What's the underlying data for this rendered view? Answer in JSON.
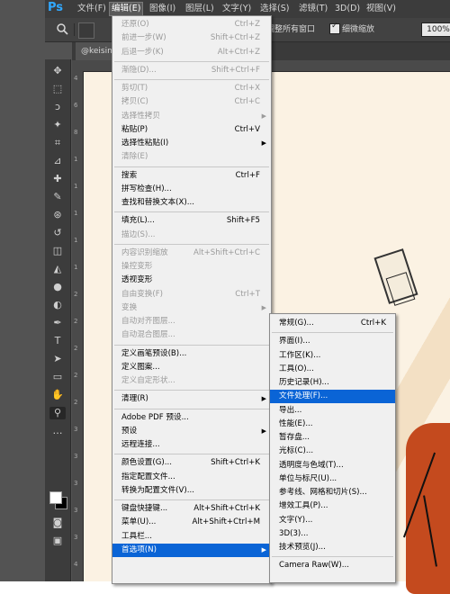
{
  "app": {
    "logo": "Ps"
  },
  "menubar": [
    "文件(F)",
    "编辑(E)",
    "图像(I)",
    "图层(L)",
    "文字(Y)",
    "选择(S)",
    "滤镜(T)",
    "3D(D)",
    "视图(V)"
  ],
  "options": {
    "check1_label": "调整所有窗口",
    "check2_label": "细微缩放",
    "zoom": "100%"
  },
  "tab": {
    "label": "@keisin"
  },
  "ruler": [
    "4",
    "6",
    "8",
    "1",
    "1",
    "1",
    "1",
    "1",
    "2",
    "2",
    "2",
    "2",
    "2",
    "3",
    "3",
    "3",
    "3",
    "3",
    "4"
  ],
  "edit_menu": [
    {
      "label": "还原(O)",
      "shortcut": "Ctrl+Z",
      "disabled": true
    },
    {
      "label": "前进一步(W)",
      "shortcut": "Shift+Ctrl+Z",
      "disabled": true
    },
    {
      "label": "后退一步(K)",
      "shortcut": "Alt+Ctrl+Z",
      "disabled": true
    },
    {
      "sep": true
    },
    {
      "label": "渐隐(D)...",
      "shortcut": "Shift+Ctrl+F",
      "disabled": true
    },
    {
      "sep": true
    },
    {
      "label": "剪切(T)",
      "shortcut": "Ctrl+X",
      "disabled": true
    },
    {
      "label": "拷贝(C)",
      "shortcut": "Ctrl+C",
      "disabled": true
    },
    {
      "label": "选择性拷贝",
      "shortcut": "",
      "disabled": true,
      "submenu": true
    },
    {
      "label": "粘贴(P)",
      "shortcut": "Ctrl+V",
      "disabled": false
    },
    {
      "label": "选择性粘贴(I)",
      "shortcut": "",
      "disabled": false,
      "submenu": true
    },
    {
      "label": "清除(E)",
      "shortcut": "",
      "disabled": true
    },
    {
      "sep": true
    },
    {
      "label": "搜索",
      "shortcut": "Ctrl+F",
      "disabled": false
    },
    {
      "label": "拼写检查(H)...",
      "shortcut": "",
      "disabled": false
    },
    {
      "label": "查找和替换文本(X)...",
      "shortcut": "",
      "disabled": false
    },
    {
      "sep": true
    },
    {
      "label": "填充(L)...",
      "shortcut": "Shift+F5",
      "disabled": false
    },
    {
      "label": "描边(S)...",
      "shortcut": "",
      "disabled": true
    },
    {
      "sep": true
    },
    {
      "label": "内容识别缩放",
      "shortcut": "Alt+Shift+Ctrl+C",
      "disabled": true
    },
    {
      "label": "操控变形",
      "shortcut": "",
      "disabled": true
    },
    {
      "label": "透视变形",
      "shortcut": "",
      "disabled": false
    },
    {
      "label": "自由变换(F)",
      "shortcut": "Ctrl+T",
      "disabled": true
    },
    {
      "label": "变换",
      "shortcut": "",
      "disabled": true,
      "submenu": true
    },
    {
      "label": "自动对齐图层...",
      "shortcut": "",
      "disabled": true
    },
    {
      "label": "自动混合图层...",
      "shortcut": "",
      "disabled": true
    },
    {
      "sep": true
    },
    {
      "label": "定义画笔预设(B)...",
      "shortcut": "",
      "disabled": false
    },
    {
      "label": "定义图案...",
      "shortcut": "",
      "disabled": false
    },
    {
      "label": "定义自定形状...",
      "shortcut": "",
      "disabled": true
    },
    {
      "sep": true
    },
    {
      "label": "清理(R)",
      "shortcut": "",
      "disabled": false,
      "submenu": true
    },
    {
      "sep": true
    },
    {
      "label": "Adobe PDF 预设...",
      "shortcut": "",
      "disabled": false
    },
    {
      "label": "预设",
      "shortcut": "",
      "disabled": false,
      "submenu": true
    },
    {
      "label": "远程连接...",
      "shortcut": "",
      "disabled": false
    },
    {
      "sep": true
    },
    {
      "label": "颜色设置(G)...",
      "shortcut": "Shift+Ctrl+K",
      "disabled": false
    },
    {
      "label": "指定配置文件...",
      "shortcut": "",
      "disabled": false
    },
    {
      "label": "转换为配置文件(V)...",
      "shortcut": "",
      "disabled": false
    },
    {
      "sep": true
    },
    {
      "label": "键盘快捷键...",
      "shortcut": "Alt+Shift+Ctrl+K",
      "disabled": false
    },
    {
      "label": "菜单(U)...",
      "shortcut": "Alt+Shift+Ctrl+M",
      "disabled": false
    },
    {
      "label": "工具栏...",
      "shortcut": "",
      "disabled": false
    },
    {
      "label": "首选项(N)",
      "shortcut": "",
      "disabled": false,
      "submenu": true,
      "highlighted": true
    }
  ],
  "prefs_menu": [
    {
      "label": "常规(G)...",
      "shortcut": "Ctrl+K"
    },
    {
      "sep": true
    },
    {
      "label": "界面(I)...",
      "shortcut": ""
    },
    {
      "label": "工作区(K)...",
      "shortcut": ""
    },
    {
      "label": "工具(O)...",
      "shortcut": ""
    },
    {
      "label": "历史记录(H)...",
      "shortcut": ""
    },
    {
      "label": "文件处理(F)...",
      "shortcut": "",
      "highlighted": true
    },
    {
      "label": "导出...",
      "shortcut": ""
    },
    {
      "label": "性能(E)...",
      "shortcut": ""
    },
    {
      "label": "暂存盘...",
      "shortcut": ""
    },
    {
      "label": "光标(C)...",
      "shortcut": ""
    },
    {
      "label": "透明度与色域(T)...",
      "shortcut": ""
    },
    {
      "label": "单位与标尺(U)...",
      "shortcut": ""
    },
    {
      "label": "参考线、网格和切片(S)...",
      "shortcut": ""
    },
    {
      "label": "增效工具(P)...",
      "shortcut": ""
    },
    {
      "label": "文字(Y)...",
      "shortcut": ""
    },
    {
      "label": "3D(3)...",
      "shortcut": ""
    },
    {
      "label": "技术预览(J)...",
      "shortcut": ""
    },
    {
      "sep": true
    },
    {
      "label": "Camera Raw(W)...",
      "shortcut": ""
    }
  ],
  "tools": [
    "move-icon",
    "marquee-icon",
    "lasso-icon",
    "magic-wand-icon",
    "crop-icon",
    "eyedropper-icon",
    "healing-brush-icon",
    "brush-icon",
    "clone-stamp-icon",
    "history-brush-icon",
    "eraser-icon",
    "paint-bucket-icon",
    "blur-icon",
    "dodge-icon",
    "pen-icon",
    "type-icon",
    "path-select-icon",
    "shape-icon",
    "hand-icon",
    "zoom-icon",
    "more-icon"
  ]
}
